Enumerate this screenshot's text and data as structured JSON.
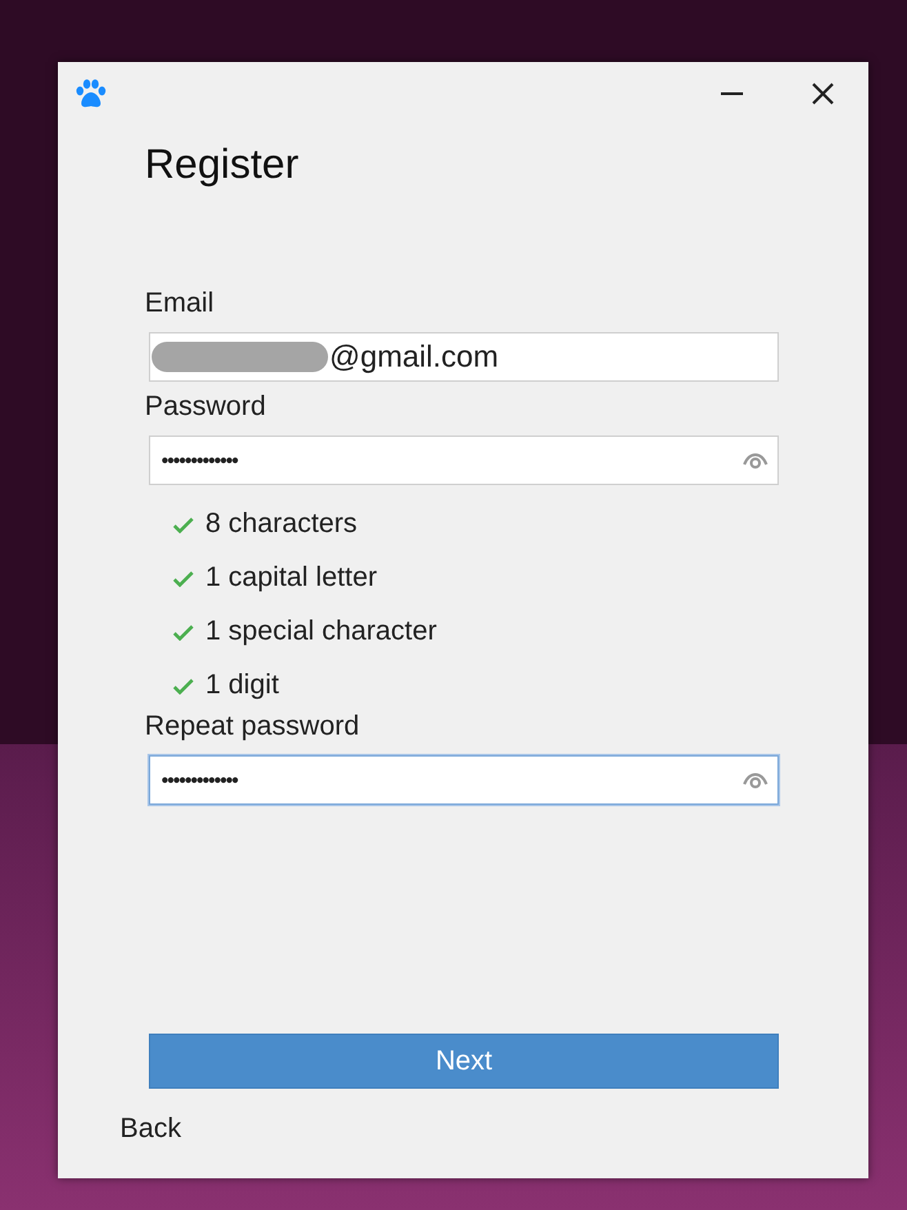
{
  "window": {
    "title": "Register"
  },
  "fields": [
    {
      "label": "Email",
      "value": "@gmail.com",
      "redacted": true,
      "reveal_icon": false,
      "focused": false
    },
    {
      "label": "Password",
      "value": "•••••••••••••",
      "redacted": false,
      "reveal_icon": true,
      "focused": false
    },
    {
      "label": "Repeat password",
      "value": "•••••••••••••",
      "redacted": false,
      "reveal_icon": true,
      "focused": true
    }
  ],
  "requirements": [
    {
      "text": "8 characters",
      "met": true
    },
    {
      "text": "1 capital letter",
      "met": true
    },
    {
      "text": "1 special character",
      "met": true
    },
    {
      "text": "1 digit",
      "met": true
    }
  ],
  "buttons": {
    "next": "Next",
    "back": "Back"
  }
}
